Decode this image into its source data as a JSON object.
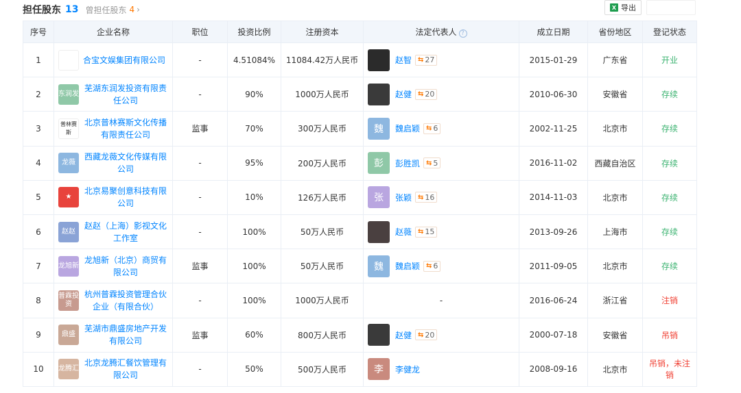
{
  "header": {
    "title": "担任股东",
    "count": "13",
    "prev_label": "曾担任股东",
    "prev_count": "4",
    "export_label": "导出"
  },
  "columns": [
    "序号",
    "企业名称",
    "职位",
    "投资比例",
    "注册资本",
    "法定代表人",
    "成立日期",
    "省份地区",
    "登记状态"
  ],
  "rows": [
    {
      "idx": "1",
      "logo": {
        "text": "",
        "color": "#ffffff"
      },
      "name": "合宝文娱集团有限公司",
      "position": "-",
      "ratio": "4.51084%",
      "capital": "11084.42万人民币",
      "rep": {
        "name": "赵智",
        "avatar": {
          "text": "",
          "color": "#2b2b2b"
        },
        "count": "27"
      },
      "date": "2015-01-29",
      "region": "广东省",
      "status": "开业",
      "status_color": "green"
    },
    {
      "idx": "2",
      "logo": {
        "text": "东润发",
        "color": "#8fc8a7"
      },
      "name": "芜湖东润发投资有限责任公司",
      "position": "-",
      "ratio": "90%",
      "capital": "1000万人民币",
      "rep": {
        "name": "赵健",
        "avatar": {
          "text": "",
          "color": "#3a3a3a"
        },
        "count": "20"
      },
      "date": "2010-06-30",
      "region": "安徽省",
      "status": "存续",
      "status_color": "green"
    },
    {
      "idx": "3",
      "logo": {
        "text": "普林赛斯",
        "color": "#ffffff"
      },
      "name": "北京普林赛斯文化传播有限责任公司",
      "position": "监事",
      "ratio": "70%",
      "capital": "300万人民币",
      "rep": {
        "name": "魏启颖",
        "avatar": {
          "text": "魏",
          "color": "#8db7e0"
        },
        "count": "6"
      },
      "date": "2002-11-25",
      "region": "北京市",
      "status": "存续",
      "status_color": "green"
    },
    {
      "idx": "4",
      "logo": {
        "text": "龙薇",
        "color": "#8db7e0"
      },
      "name": "西藏龙薇文化传媒有限公司",
      "position": "-",
      "ratio": "95%",
      "capital": "200万人民币",
      "rep": {
        "name": "彭胜凯",
        "avatar": {
          "text": "彭",
          "color": "#8fc8a7"
        },
        "count": "5"
      },
      "date": "2016-11-02",
      "region": "西藏自治区",
      "status": "存续",
      "status_color": "green"
    },
    {
      "idx": "5",
      "logo": {
        "text": "★",
        "color": "#e8433c"
      },
      "name": "北京易聚创意科技有限公司",
      "position": "-",
      "ratio": "10%",
      "capital": "126万人民币",
      "rep": {
        "name": "张颖",
        "avatar": {
          "text": "张",
          "color": "#b9a6e0"
        },
        "count": "16"
      },
      "date": "2014-11-03",
      "region": "北京市",
      "status": "存续",
      "status_color": "green"
    },
    {
      "idx": "6",
      "logo": {
        "text": "赵赵",
        "color": "#8aa3d6"
      },
      "name": "赵赵（上海）影视文化工作室",
      "position": "-",
      "ratio": "100%",
      "capital": "50万人民币",
      "rep": {
        "name": "赵薇",
        "avatar": {
          "text": "",
          "color": "#4a4040"
        },
        "count": "15"
      },
      "date": "2013-09-26",
      "region": "上海市",
      "status": "存续",
      "status_color": "green"
    },
    {
      "idx": "7",
      "logo": {
        "text": "龙旭新",
        "color": "#b9a6e0"
      },
      "name": "龙旭新（北京）商贸有限公司",
      "position": "监事",
      "ratio": "100%",
      "capital": "50万人民币",
      "rep": {
        "name": "魏启颖",
        "avatar": {
          "text": "魏",
          "color": "#8db7e0"
        },
        "count": "6"
      },
      "date": "2011-09-05",
      "region": "北京市",
      "status": "存续",
      "status_color": "green"
    },
    {
      "idx": "8",
      "logo": {
        "text": "普霖投资",
        "color": "#c79a8f"
      },
      "name": "杭州普霖投资管理合伙企业（有限合伙）",
      "position": "-",
      "ratio": "100%",
      "capital": "1000万人民币",
      "rep": null,
      "rep_placeholder": "-",
      "date": "2016-06-24",
      "region": "浙江省",
      "status": "注销",
      "status_color": "red"
    },
    {
      "idx": "9",
      "logo": {
        "text": "鼎盛",
        "color": "#c9a896"
      },
      "name": "芜湖市鼎盛房地产开发有限公司",
      "position": "监事",
      "ratio": "60%",
      "capital": "800万人民币",
      "rep": {
        "name": "赵健",
        "avatar": {
          "text": "",
          "color": "#3a3a3a"
        },
        "count": "20"
      },
      "date": "2000-07-18",
      "region": "安徽省",
      "status": "吊销",
      "status_color": "red"
    },
    {
      "idx": "10",
      "logo": {
        "text": "龙腾汇",
        "color": "#d6b5a0"
      },
      "name": "北京龙腾汇餐饮管理有限公司",
      "position": "-",
      "ratio": "50%",
      "capital": "500万人民币",
      "rep": {
        "name": "李健龙",
        "avatar": {
          "text": "李",
          "color": "#c98a7e"
        },
        "count": ""
      },
      "date": "2008-09-16",
      "region": "北京市",
      "status": "吊销，未注销",
      "status_color": "red"
    }
  ]
}
